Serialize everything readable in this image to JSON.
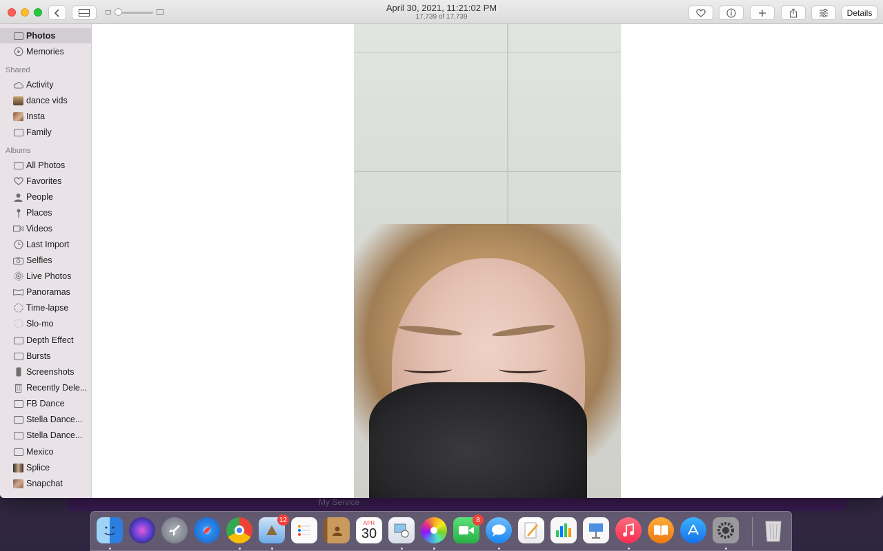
{
  "window": {
    "title_date": "April 30, 2021, 11:21:02 PM",
    "title_count": "17,739 of 17,739",
    "details_label": "Details",
    "toolbar_icons": [
      "heart-icon",
      "info-icon",
      "plus-icon",
      "share-icon",
      "adjust-icon"
    ]
  },
  "sidebar": {
    "top_items": [
      {
        "label": "Photos",
        "icon": "album-icon",
        "selected": true
      },
      {
        "label": "Memories",
        "icon": "memories-icon"
      }
    ],
    "shared_header": "Shared",
    "shared_items": [
      {
        "label": "Activity",
        "icon": "cloud-icon"
      },
      {
        "label": "dance vids",
        "icon": "thumbnail-icon"
      },
      {
        "label": "Insta",
        "icon": "thumbnail-icon"
      },
      {
        "label": "Family",
        "icon": "album-icon"
      }
    ],
    "albums_header": "Albums",
    "album_items": [
      {
        "label": "All Photos",
        "icon": "album-icon"
      },
      {
        "label": "Favorites",
        "icon": "heart-icon"
      },
      {
        "label": "People",
        "icon": "person-icon"
      },
      {
        "label": "Places",
        "icon": "pin-icon"
      },
      {
        "label": "Videos",
        "icon": "video-icon"
      },
      {
        "label": "Last Import",
        "icon": "clock-icon"
      },
      {
        "label": "Selfies",
        "icon": "camera-icon"
      },
      {
        "label": "Live Photos",
        "icon": "live-icon"
      },
      {
        "label": "Panoramas",
        "icon": "panorama-icon"
      },
      {
        "label": "Time-lapse",
        "icon": "timelapse-icon"
      },
      {
        "label": "Slo-mo",
        "icon": "slomo-icon"
      },
      {
        "label": "Depth Effect",
        "icon": "album-icon"
      },
      {
        "label": "Bursts",
        "icon": "album-icon"
      },
      {
        "label": "Screenshots",
        "icon": "phone-icon"
      },
      {
        "label": "Recently Dele...",
        "icon": "trash-icon"
      },
      {
        "label": "FB Dance",
        "icon": "album-icon"
      },
      {
        "label": "Stella Dance...",
        "icon": "album-icon"
      },
      {
        "label": "Stella Dance...",
        "icon": "album-icon"
      },
      {
        "label": "Mexico",
        "icon": "album-icon"
      },
      {
        "label": "Splice",
        "icon": "thumbnail-icon"
      },
      {
        "label": "Snapchat",
        "icon": "thumbnail-icon"
      }
    ]
  },
  "background_window": {
    "text": "My Service"
  },
  "dock": {
    "apps": [
      {
        "name": "finder-icon",
        "color": "#3a8ee8"
      },
      {
        "name": "siri-icon",
        "color": "#5a3fd0"
      },
      {
        "name": "launchpad-icon",
        "color": "#8a8f98"
      },
      {
        "name": "safari-icon",
        "color": "#2d8cf0"
      },
      {
        "name": "chrome-icon",
        "color": "#ffffff"
      },
      {
        "name": "mail-icon",
        "color": "#6aa9e8",
        "badge": "12"
      },
      {
        "name": "reminders-icon",
        "color": "#fafafa"
      },
      {
        "name": "contacts-icon",
        "color": "#b98a4e"
      },
      {
        "name": "calendar-icon",
        "color": "#ffffff",
        "month": "APR",
        "day": "30"
      },
      {
        "name": "preview-icon",
        "color": "#e9eef5"
      },
      {
        "name": "photos-icon",
        "color": "#ffffff"
      },
      {
        "name": "facetime-icon",
        "color": "#3ac052",
        "badge": "8"
      },
      {
        "name": "messages-icon",
        "color": "#4fa3f7"
      },
      {
        "name": "pages-icon",
        "color": "#f0a23b"
      },
      {
        "name": "numbers-icon",
        "color": "#f7f7f7"
      },
      {
        "name": "keynote-icon",
        "color": "#f7f7f7"
      },
      {
        "name": "music-icon",
        "color": "#fb4a62"
      },
      {
        "name": "books-icon",
        "color": "#f58c1c"
      },
      {
        "name": "app-store-icon",
        "color": "#1c8df5"
      },
      {
        "name": "system-preferences-icon",
        "color": "#8a8a8e"
      },
      {
        "name": "trash-icon",
        "color": "#d7d7d7"
      }
    ]
  }
}
